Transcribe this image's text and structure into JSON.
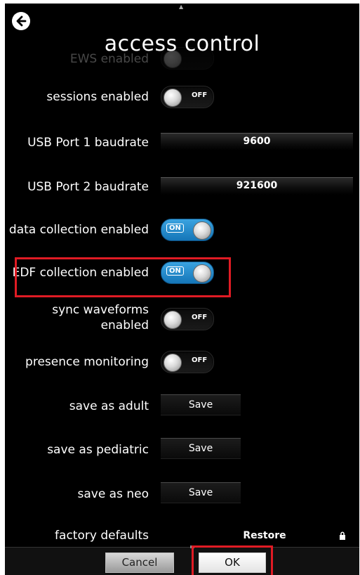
{
  "header": {
    "title": "access control"
  },
  "settings": {
    "partial_label": "EWS enabled",
    "sessions_label": "sessions enabled",
    "sessions_state": "OFF",
    "usb1_label": "USB Port 1 baudrate",
    "usb1_value": "9600",
    "usb2_label": "USB Port 2 baudrate",
    "usb2_value": "921600",
    "data_collection_label": "data collection enabled",
    "data_collection_state": "ON",
    "edf_label": "EDF collection enabled",
    "edf_state": "ON",
    "sync_label_line1": "sync waveforms",
    "sync_label_line2": "enabled",
    "sync_state": "OFF",
    "presence_label": "presence monitoring",
    "presence_state": "OFF",
    "adult_label": "save as adult",
    "adult_button": "Save",
    "pediatric_label": "save as pediatric",
    "pediatric_button": "Save",
    "neo_label": "save as neo",
    "neo_button": "Save",
    "factory_label": "factory defaults",
    "factory_button": "Restore"
  },
  "footer": {
    "cancel_label": "Cancel",
    "ok_label": "OK"
  },
  "colors": {
    "highlight": "#e01b24",
    "toggle_on": "#1f88cc",
    "background": "#000000"
  },
  "icons": {
    "back": "back-arrow-icon",
    "lock": "lock-icon"
  }
}
